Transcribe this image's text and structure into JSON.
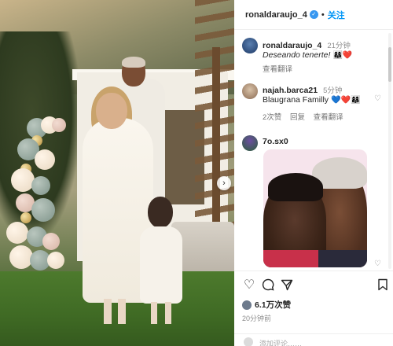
{
  "header": {
    "username": "ronaldaraujo_4",
    "separator": "•",
    "follow_label": "关注"
  },
  "caption": {
    "username": "ronaldaraujo_4",
    "time": "21分钟",
    "text": "Deseando tenerte!",
    "emojis": "👩‍👩‍👧❤️",
    "see_translation": "查看翻译"
  },
  "comments": [
    {
      "username": "najah.barca21",
      "time": "5分钟",
      "text": "Blaugrana Familly",
      "emojis": "💙❤️👩‍👩‍👧",
      "likes": "2次赞",
      "reply_label": "回复",
      "see_translation": "查看翻译"
    },
    {
      "username": "7o.sx0"
    }
  ],
  "post": {
    "likes": "6.1万次赞",
    "posted": "20分钟前",
    "add_comment_placeholder": "添加评论……"
  },
  "icons": {
    "verified": "verified-badge-icon",
    "like": "heart-icon",
    "comment": "comment-icon",
    "share": "send-icon",
    "save": "bookmark-icon",
    "next": "chevron-right-icon"
  },
  "colors": {
    "accent": "#0095f6",
    "verified": "#3897f0"
  }
}
